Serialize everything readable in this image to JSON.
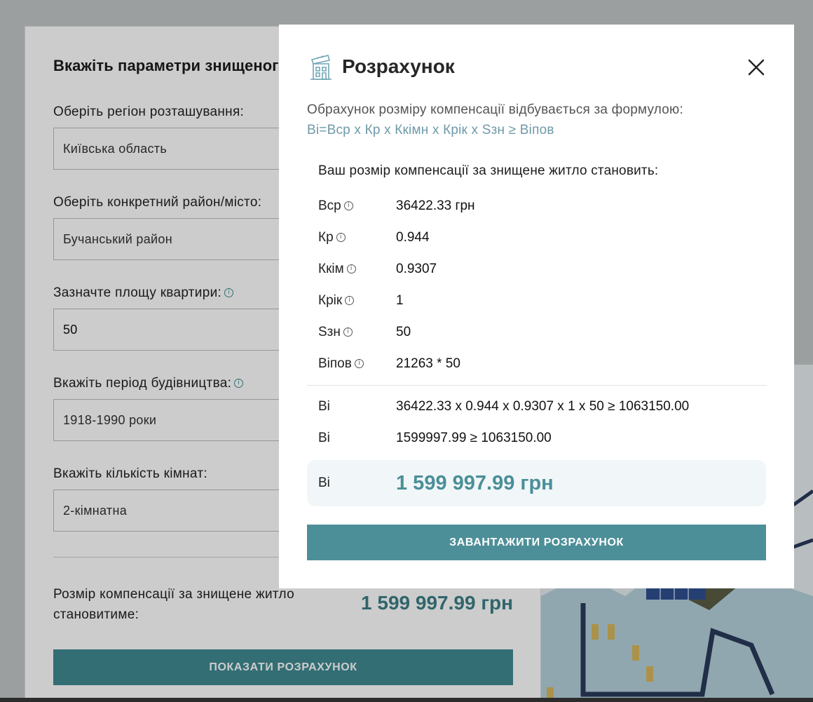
{
  "form": {
    "title": "Вкажіть параметри знищеного житла",
    "region": {
      "label": "Оберіть регіон розташування:",
      "value": "Київська область"
    },
    "district": {
      "label": "Оберіть конкретний район/місто:",
      "value": "Бучанський район"
    },
    "area": {
      "label": "Зазначте площу квартири:",
      "value": "50"
    },
    "period": {
      "label": "Вкажіть період будівництва:",
      "value": "1918-1990 роки"
    },
    "rooms": {
      "label": "Вкажіть кількість кімнат:",
      "value": "2-кімнатна"
    },
    "compensation_label": "Розмір компенсації за знищене житло становитиме:",
    "compensation_value": "1 599 997.99 грн",
    "show_button": "ПОКАЗАТИ РОЗРАХУНОК"
  },
  "modal": {
    "title": "Розрахунок",
    "formula_intro": "Обрахунок розміру компенсації відбувається за формулою:",
    "formula": "Ві=Вср х Кр х Ккімн х Крік х Sзн ≥ Віпов",
    "result_heading": "Ваш розмір компенсації за знищене житло становить:",
    "info_glyph": "i",
    "params": [
      {
        "name": "Вср",
        "value": "36422.33 грн"
      },
      {
        "name": "Кр",
        "value": "0.944"
      },
      {
        "name": "Ккім",
        "value": "0.9307"
      },
      {
        "name": "Крік",
        "value": "1"
      },
      {
        "name": "Sзн",
        "value": "50"
      },
      {
        "name": "Віпов",
        "value": "21263 * 50"
      }
    ],
    "calc": [
      {
        "name": "Ві",
        "value": "36422.33 х 0.944 х 0.9307 х 1 х 50 ≥ 1063150.00"
      },
      {
        "name": "Ві",
        "value": "1599997.99 ≥ 1063150.00"
      }
    ],
    "total": {
      "name": "Ві",
      "value": "1 599 997.99 грн"
    },
    "download_button": "ЗАВАНТАЖИТИ РОЗРАХУНОК"
  },
  "colors": {
    "accent": "#4d8f98",
    "accent_text": "#4a8f98",
    "formula": "#6f9aa8",
    "total_bg": "#f1f6f8"
  }
}
